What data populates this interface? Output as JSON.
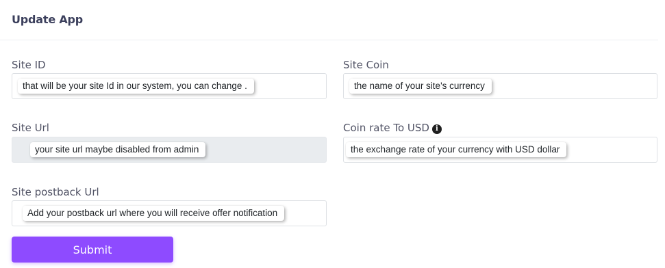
{
  "card": {
    "title": "Update App"
  },
  "form": {
    "site_id": {
      "label": "Site ID",
      "value": "",
      "tooltip": "that will be your site Id in our system, you can change ."
    },
    "site_coin": {
      "label": "Site Coin",
      "value": "",
      "tooltip": "the name of your site's currency"
    },
    "site_url": {
      "label": "Site Url",
      "value": "",
      "disabled": true,
      "tooltip": "your site url maybe disabled from admin"
    },
    "coin_rate": {
      "label": "Coin rate To USD",
      "info_icon": "info-circle-icon",
      "info_glyph": "i",
      "value": "",
      "tooltip": "the exchange rate of your currency with USD dollar"
    },
    "postback_url": {
      "label": "Site postback Url",
      "value": "",
      "tooltip": "Add your postback url where you will receive offer notification"
    },
    "submit_label": "Submit"
  },
  "colors": {
    "accent": "#8e4bff",
    "title": "#3b3f5c",
    "disabled_bg": "#e9ecef"
  }
}
